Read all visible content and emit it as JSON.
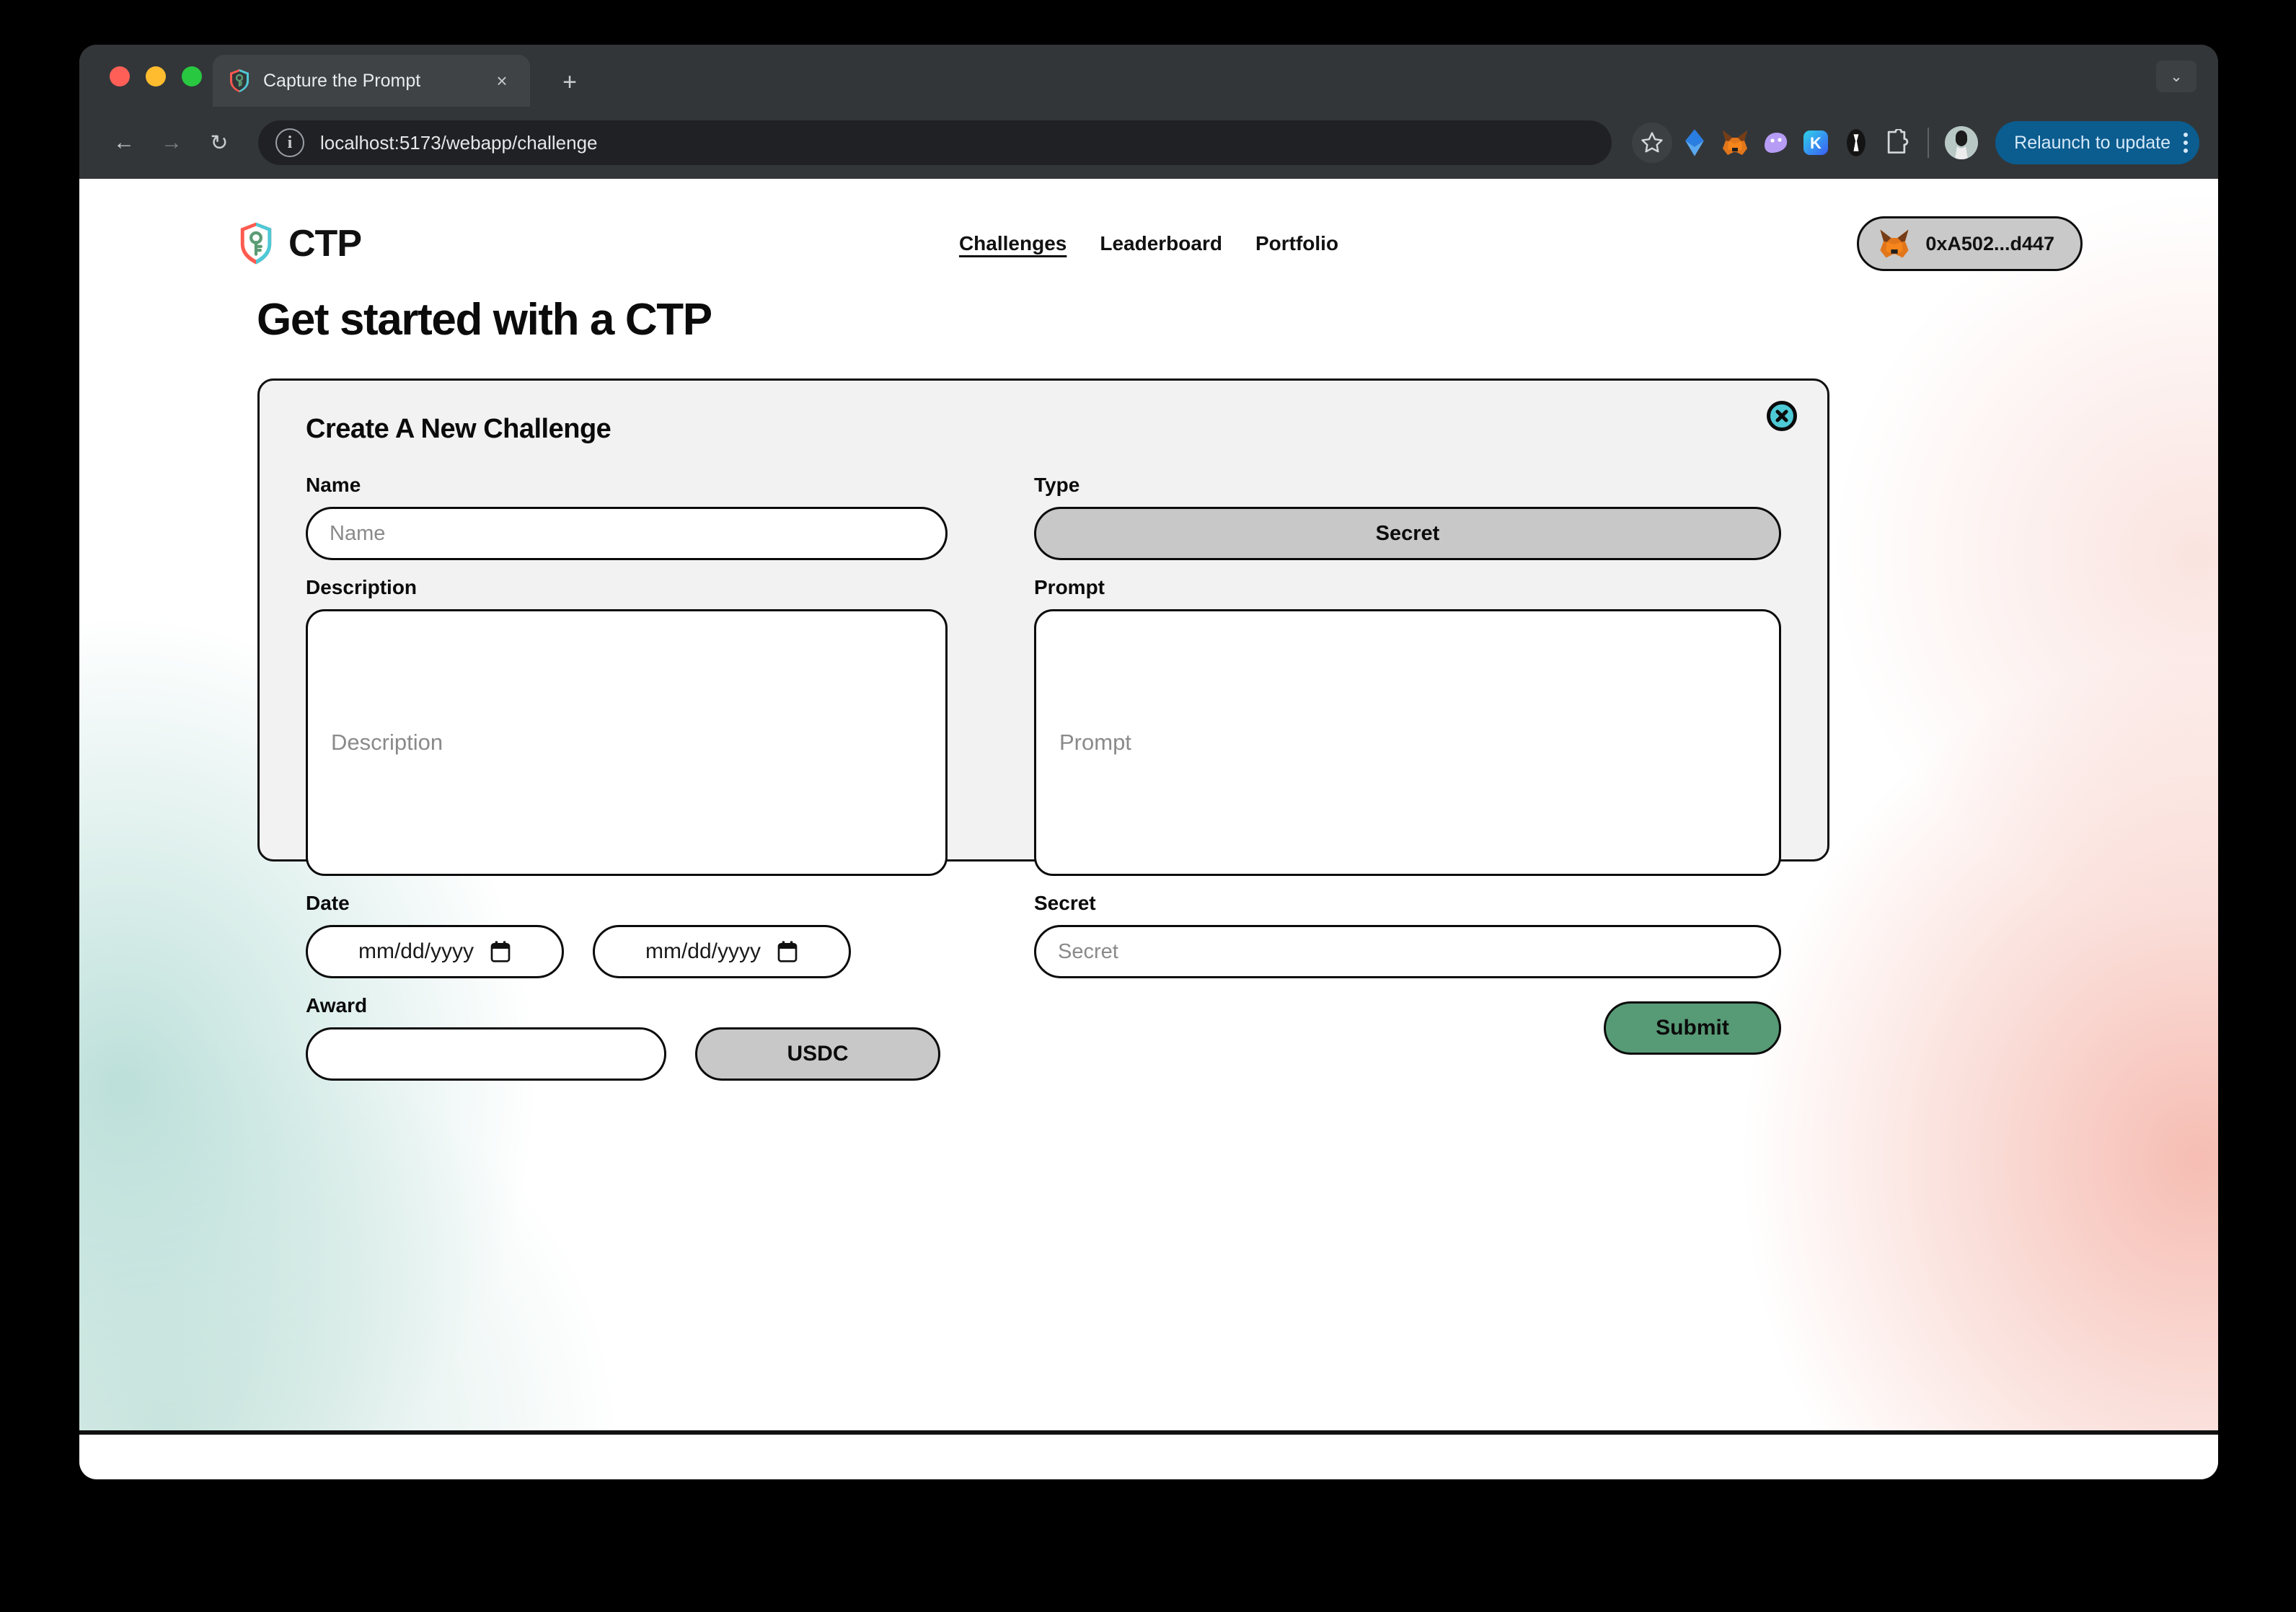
{
  "browser": {
    "tab": {
      "title": "Capture the Prompt",
      "favicon": "ctp-shield-icon",
      "close_label": "×"
    },
    "new_tab_label": "+",
    "window_menu_label": "⌄",
    "toolbar": {
      "back_label": "←",
      "forward_label": "→",
      "reload_label": "↻",
      "site_info_label": "i",
      "url": "localhost:5173/webapp/challenge",
      "bookmark_label": "☆",
      "extensions": [
        {
          "name": "blue-diamond-extension-icon"
        },
        {
          "name": "metamask-fox-extension-icon"
        },
        {
          "name": "purple-ghost-extension-icon"
        },
        {
          "name": "keplr-extension-icon",
          "label": "K"
        },
        {
          "name": "black-capsule-extension-icon"
        },
        {
          "name": "puzzle-piece-extensions-icon"
        }
      ],
      "relaunch_label": "Relaunch to update"
    }
  },
  "app": {
    "brand": {
      "name": "CTP",
      "logo": "ctp-shield-key-logo"
    },
    "nav": [
      {
        "label": "Challenges",
        "active": true
      },
      {
        "label": "Leaderboard",
        "active": false
      },
      {
        "label": "Portfolio",
        "active": false
      }
    ],
    "wallet": {
      "icon": "metamask-fox-icon",
      "address": "0xA502...d447"
    },
    "page_title": "Get started with a CTP",
    "card": {
      "title": "Create A New Challenge",
      "close_label": "✕",
      "fields": {
        "name": {
          "label": "Name",
          "value": "",
          "placeholder": "Name"
        },
        "type": {
          "label": "Type",
          "value": "Secret"
        },
        "description": {
          "label": "Description",
          "value": "",
          "placeholder": "Description"
        },
        "prompt": {
          "label": "Prompt",
          "value": "",
          "placeholder": "Prompt"
        },
        "date": {
          "label": "Date",
          "start": {
            "value": "",
            "placeholder": "mm/dd/yyyy"
          },
          "end": {
            "value": "",
            "placeholder": "mm/dd/yyyy"
          }
        },
        "secret": {
          "label": "Secret",
          "value": "",
          "placeholder": "Secret"
        },
        "award": {
          "label": "Award",
          "amount": {
            "value": "",
            "placeholder": ""
          },
          "currency": "USDC"
        }
      },
      "submit_label": "Submit"
    },
    "colors": {
      "accent_green": "#579a76",
      "close_cyan": "#4ec9d6",
      "select_gray": "#c8c8c8",
      "card_bg": "#f2f2f3",
      "border": "#0b0b0b"
    }
  }
}
